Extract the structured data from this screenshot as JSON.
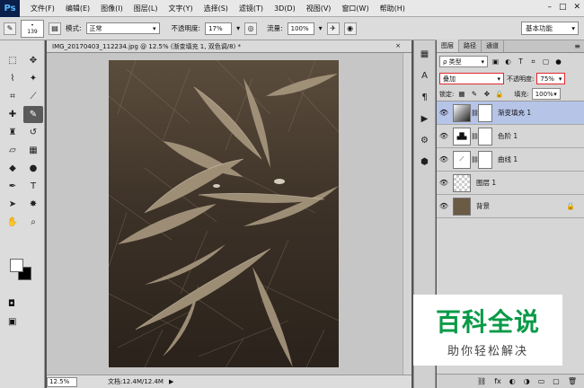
{
  "app": {
    "logo": "Ps"
  },
  "menubar": {
    "items": [
      "文件(F)",
      "编辑(E)",
      "图像(I)",
      "图层(L)",
      "文字(Y)",
      "选择(S)",
      "滤镜(T)",
      "3D(D)",
      "视图(V)",
      "窗口(W)",
      "帮助(H)"
    ],
    "window_controls": [
      "–",
      "□",
      "✕"
    ]
  },
  "options": {
    "brush_size": "139",
    "mode_label": "模式:",
    "mode_value": "正常",
    "opacity_label": "不透明度:",
    "opacity_value": "17%",
    "flow_label": "流量:",
    "flow_value": "100%",
    "workspace": "基本功能"
  },
  "document": {
    "tab_title": "IMG_20170403_112234.jpg @ 12.5% (渐变填充 1, 双色调/8) *",
    "tab_close": "×",
    "zoom": "12.5%",
    "doc_info": "文档:12.4M/12.4M"
  },
  "tools": [
    {
      "name": "marquee-tool",
      "glyph": "⬚"
    },
    {
      "name": "move-tool",
      "glyph": "✥"
    },
    {
      "name": "lasso-tool",
      "glyph": "⌇"
    },
    {
      "name": "magic-wand-tool",
      "glyph": "✦"
    },
    {
      "name": "crop-tool",
      "glyph": "⌗"
    },
    {
      "name": "eyedropper-tool",
      "glyph": "⟋"
    },
    {
      "name": "healing-tool",
      "glyph": "✚"
    },
    {
      "name": "brush-tool",
      "glyph": "✎"
    },
    {
      "name": "stamp-tool",
      "glyph": "♜"
    },
    {
      "name": "history-brush-tool",
      "glyph": "↺"
    },
    {
      "name": "eraser-tool",
      "glyph": "▱"
    },
    {
      "name": "gradient-tool",
      "glyph": "▦"
    },
    {
      "name": "blur-tool",
      "glyph": "◆"
    },
    {
      "name": "dodge-tool",
      "glyph": "●"
    },
    {
      "name": "pen-tool",
      "glyph": "✒"
    },
    {
      "name": "type-tool",
      "glyph": "T"
    },
    {
      "name": "path-select-tool",
      "glyph": "➤"
    },
    {
      "name": "shape-tool",
      "glyph": "✸"
    },
    {
      "name": "hand-tool",
      "glyph": "✋"
    },
    {
      "name": "zoom-tool",
      "glyph": "⌕"
    }
  ],
  "side_icons": [
    "▦",
    "A",
    "¶",
    "▶",
    "⚙",
    "⬢"
  ],
  "layers_panel": {
    "tabs": [
      "图层",
      "路径",
      "通道"
    ],
    "filter_kind": "ρ 类型",
    "blend_mode": "叠加",
    "opacity_label": "不透明度:",
    "opacity_value": "75%",
    "lock_label": "锁定:",
    "fill_label": "填充:",
    "fill_value": "100%",
    "layers": [
      {
        "name": "渐变填充 1",
        "thumb": "grad",
        "mask": true,
        "selected": true
      },
      {
        "name": "色阶 1",
        "thumb": "levels",
        "mask": true,
        "selected": false
      },
      {
        "name": "曲线 1",
        "thumb": "curves",
        "mask": true,
        "selected": false
      },
      {
        "name": "图层 1",
        "thumb": "trans",
        "mask": false,
        "selected": false
      },
      {
        "name": "背景",
        "thumb": "bg",
        "mask": false,
        "selected": false,
        "locked": true
      }
    ],
    "bottom_icons": [
      "⛓",
      "fx",
      "◐",
      "◑",
      "▭",
      "▢",
      "🗑"
    ]
  },
  "watermark": {
    "title": "百科全说",
    "subtitle": "助你轻松解决"
  },
  "colors": {
    "accent": "#b6c4e8",
    "highlight": "#e0292e",
    "watermark": "#0a9a48"
  }
}
